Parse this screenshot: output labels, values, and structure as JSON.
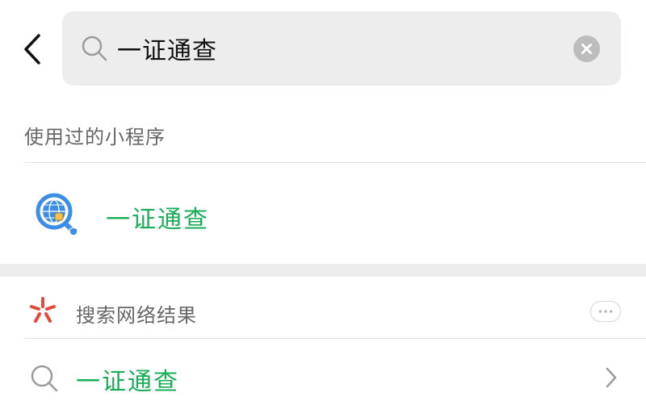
{
  "search": {
    "query": "一证通查",
    "placeholder": ""
  },
  "used_miniprograms": {
    "title": "使用过的小程序",
    "items": [
      {
        "name": "一证通查",
        "icon": "magnifier-globe-icon"
      }
    ]
  },
  "web_results": {
    "title": "搜索网络结果",
    "logo": "search-logo-icon",
    "items": [
      {
        "text": "一证通查"
      }
    ]
  },
  "colors": {
    "accent_green": "#1aad57",
    "search_bg": "#ededed",
    "band_bg": "#ededed",
    "logo_red": "#e8473c",
    "icon_blue": "#3a8ee6"
  }
}
